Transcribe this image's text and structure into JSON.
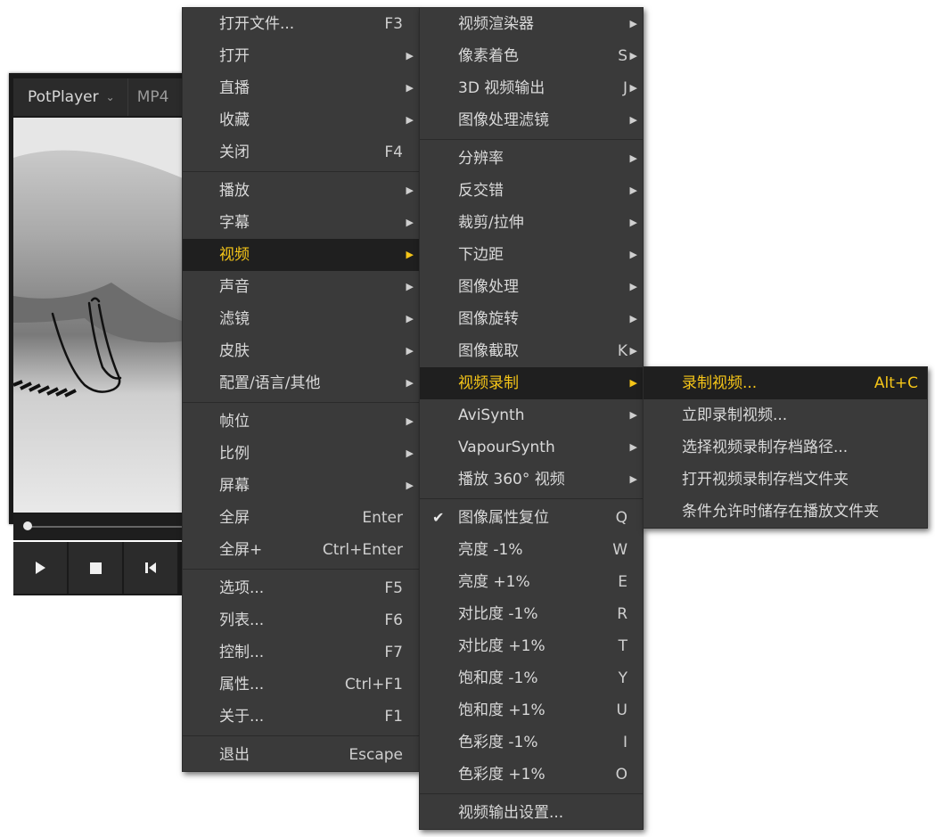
{
  "player": {
    "app_name": "PotPlayer",
    "format": "MP4"
  },
  "main_menu": [
    {
      "label": "打开文件...",
      "shortcut": "F3",
      "arrow": false
    },
    {
      "label": "打开",
      "shortcut": "",
      "arrow": true
    },
    {
      "label": "直播",
      "shortcut": "",
      "arrow": true
    },
    {
      "label": "收藏",
      "shortcut": "",
      "arrow": true
    },
    {
      "label": "关闭",
      "shortcut": "F4",
      "arrow": false
    },
    {
      "sep": true
    },
    {
      "label": "播放",
      "shortcut": "",
      "arrow": true
    },
    {
      "label": "字幕",
      "shortcut": "",
      "arrow": true
    },
    {
      "label": "视频",
      "shortcut": "",
      "arrow": true,
      "highlight": true
    },
    {
      "label": "声音",
      "shortcut": "",
      "arrow": true
    },
    {
      "label": "滤镜",
      "shortcut": "",
      "arrow": true
    },
    {
      "label": "皮肤",
      "shortcut": "",
      "arrow": true
    },
    {
      "label": "配置/语言/其他",
      "shortcut": "",
      "arrow": true
    },
    {
      "sep": true
    },
    {
      "label": "帧位",
      "shortcut": "",
      "arrow": true
    },
    {
      "label": "比例",
      "shortcut": "",
      "arrow": true
    },
    {
      "label": "屏幕",
      "shortcut": "",
      "arrow": true
    },
    {
      "label": "全屏",
      "shortcut": "Enter",
      "arrow": false
    },
    {
      "label": "全屏+",
      "shortcut": "Ctrl+Enter",
      "arrow": false
    },
    {
      "sep": true
    },
    {
      "label": "选项...",
      "shortcut": "F5",
      "arrow": false
    },
    {
      "label": "列表...",
      "shortcut": "F6",
      "arrow": false
    },
    {
      "label": "控制...",
      "shortcut": "F7",
      "arrow": false
    },
    {
      "label": "属性...",
      "shortcut": "Ctrl+F1",
      "arrow": false
    },
    {
      "label": "关于...",
      "shortcut": "F1",
      "arrow": false
    },
    {
      "sep": true
    },
    {
      "label": "退出",
      "shortcut": "Escape",
      "arrow": false
    }
  ],
  "video_menu": [
    {
      "label": "视频渲染器",
      "shortcut": "",
      "arrow": true
    },
    {
      "label": "像素着色",
      "shortcut": "S",
      "arrow": true
    },
    {
      "label": "3D 视频输出",
      "shortcut": "J",
      "arrow": true
    },
    {
      "label": "图像处理滤镜",
      "shortcut": "",
      "arrow": true
    },
    {
      "sep": true
    },
    {
      "label": "分辨率",
      "shortcut": "",
      "arrow": true
    },
    {
      "label": "反交错",
      "shortcut": "",
      "arrow": true
    },
    {
      "label": "裁剪/拉伸",
      "shortcut": "",
      "arrow": true
    },
    {
      "label": "下边距",
      "shortcut": "",
      "arrow": true
    },
    {
      "label": "图像处理",
      "shortcut": "",
      "arrow": true
    },
    {
      "label": "图像旋转",
      "shortcut": "",
      "arrow": true
    },
    {
      "label": "图像截取",
      "shortcut": "K",
      "arrow": true
    },
    {
      "label": "视频录制",
      "shortcut": "",
      "arrow": true,
      "highlight": true
    },
    {
      "label": "AviSynth",
      "shortcut": "",
      "arrow": true
    },
    {
      "label": "VapourSynth",
      "shortcut": "",
      "arrow": true
    },
    {
      "label": "播放 360° 视频",
      "shortcut": "",
      "arrow": true
    },
    {
      "sep": true
    },
    {
      "label": "图像属性复位",
      "shortcut": "Q",
      "arrow": false,
      "checked": true
    },
    {
      "label": "亮度 -1%",
      "shortcut": "W",
      "arrow": false
    },
    {
      "label": "亮度 +1%",
      "shortcut": "E",
      "arrow": false
    },
    {
      "label": "对比度 -1%",
      "shortcut": "R",
      "arrow": false
    },
    {
      "label": "对比度 +1%",
      "shortcut": "T",
      "arrow": false
    },
    {
      "label": "饱和度 -1%",
      "shortcut": "Y",
      "arrow": false
    },
    {
      "label": "饱和度 +1%",
      "shortcut": "U",
      "arrow": false
    },
    {
      "label": "色彩度 -1%",
      "shortcut": "I",
      "arrow": false
    },
    {
      "label": "色彩度 +1%",
      "shortcut": "O",
      "arrow": false
    },
    {
      "sep": true
    },
    {
      "label": "视频输出设置...",
      "shortcut": "",
      "arrow": false
    }
  ],
  "record_menu": [
    {
      "label": "录制视频...",
      "shortcut": "Alt+C",
      "arrow": false,
      "highlight": true
    },
    {
      "label": "立即录制视频...",
      "shortcut": "",
      "arrow": false
    },
    {
      "label": "选择视频录制存档路径...",
      "shortcut": "",
      "arrow": false
    },
    {
      "label": "打开视频录制存档文件夹",
      "shortcut": "",
      "arrow": false
    },
    {
      "label": "条件允许时储存在播放文件夹",
      "shortcut": "",
      "arrow": false
    }
  ],
  "colors": {
    "menu_bg": "#3a3a3a",
    "highlight_bg": "#1f1f1f",
    "highlight_text": "#f5c518",
    "text": "#d9d9d9"
  },
  "icons": {
    "play": "play-icon",
    "stop": "stop-icon",
    "prev": "skip-back-icon",
    "checked": "check-icon",
    "submenu": "submenu-arrow-icon",
    "dropdown": "chevron-down-icon"
  }
}
